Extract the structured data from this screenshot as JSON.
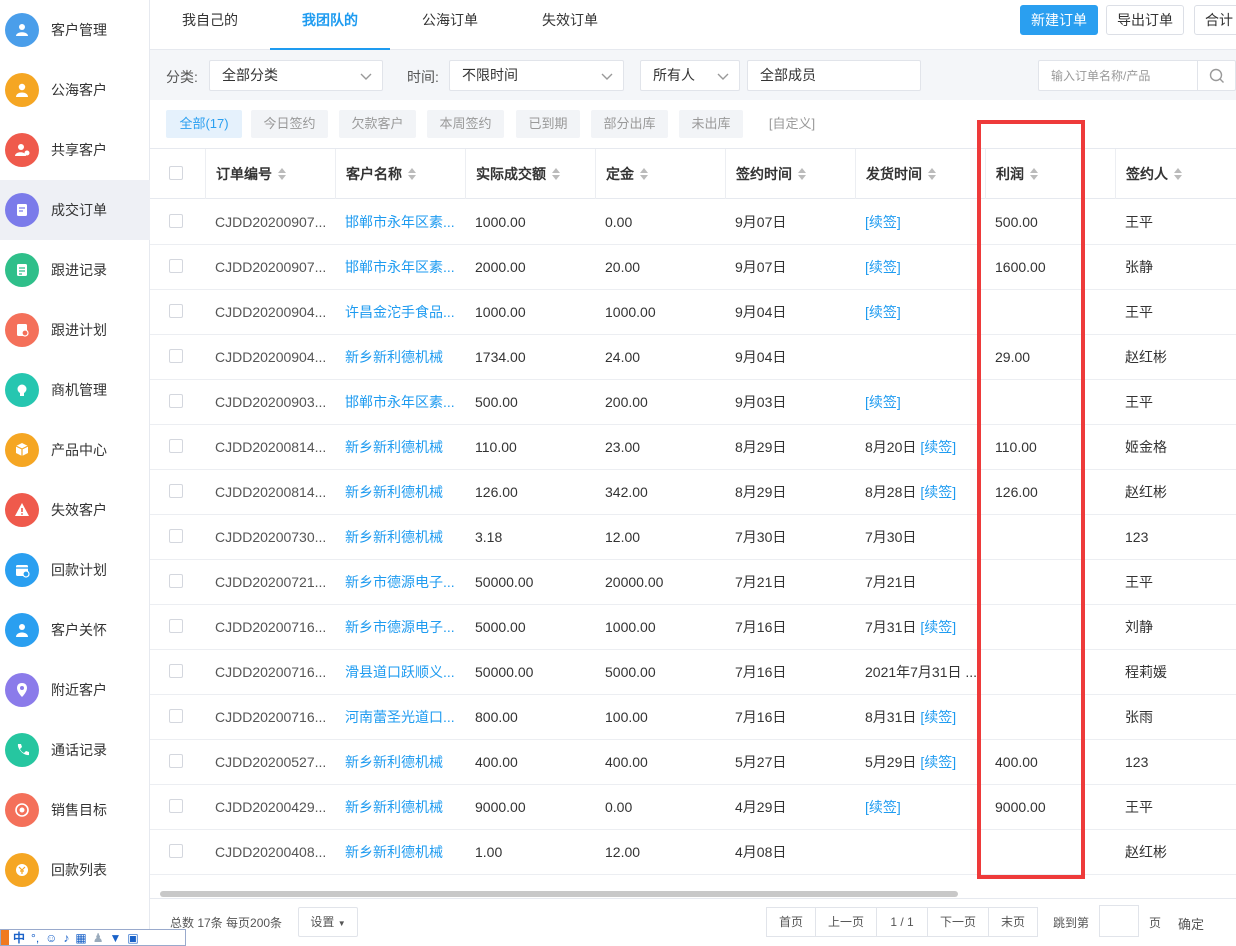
{
  "sidebar": {
    "items": [
      {
        "label": "客户管理",
        "icon": "users-icon",
        "color": "#4a9eea"
      },
      {
        "label": "公海客户",
        "icon": "person-icon",
        "color": "#f5a623"
      },
      {
        "label": "共享客户",
        "icon": "share-user-icon",
        "color": "#ef5a4c"
      },
      {
        "label": "成交订单",
        "icon": "order-icon",
        "color": "#7b7bea"
      },
      {
        "label": "跟进记录",
        "icon": "note-icon",
        "color": "#2fbf8a"
      },
      {
        "label": "跟进计划",
        "icon": "plan-icon",
        "color": "#f4705a"
      },
      {
        "label": "商机管理",
        "icon": "bulb-icon",
        "color": "#26c6b0"
      },
      {
        "label": "产品中心",
        "icon": "box-icon",
        "color": "#f5a623"
      },
      {
        "label": "失效客户",
        "icon": "warning-icon",
        "color": "#ef5a4c"
      },
      {
        "label": "回款计划",
        "icon": "calendar-icon",
        "color": "#2a9ff0"
      },
      {
        "label": "客户关怀",
        "icon": "care-icon",
        "color": "#2a9ff0"
      },
      {
        "label": "附近客户",
        "icon": "location-icon",
        "color": "#8b7bea"
      },
      {
        "label": "通话记录",
        "icon": "phone-icon",
        "color": "#26c6a0"
      },
      {
        "label": "销售目标",
        "icon": "target-icon",
        "color": "#f4705a"
      },
      {
        "label": "回款列表",
        "icon": "money-icon",
        "color": "#f5a623"
      }
    ]
  },
  "tabs": [
    "我自己的",
    "我团队的",
    "公海订单",
    "失效订单"
  ],
  "actions": {
    "new_order": "新建订单",
    "export": "导出订单",
    "total": "合计"
  },
  "filters": {
    "category_label": "分类:",
    "category_value": "全部分类",
    "time_label": "时间:",
    "time_value": "不限时间",
    "owner_value": "所有人",
    "members_value": "全部成员",
    "search_placeholder": "输入订单名称/产品"
  },
  "quick_filters": [
    "全部(17)",
    "今日签约",
    "欠款客户",
    "本周签约",
    "已到期",
    "部分出库",
    "未出库",
    "[自定义]"
  ],
  "table": {
    "columns": [
      "订单编号",
      "客户名称",
      "实际成交额",
      "定金",
      "签约时间",
      "发货时间",
      "利润",
      "签约人"
    ],
    "renew_label": "[续签]",
    "rows": [
      {
        "id": "CJDD20200907...",
        "customer": "邯郸市永年区素...",
        "amount": "1000.00",
        "deposit": "0.00",
        "sign": "9月07日",
        "ship": "",
        "renew": true,
        "profit": "500.00",
        "signer": "王平"
      },
      {
        "id": "CJDD20200907...",
        "customer": "邯郸市永年区素...",
        "amount": "2000.00",
        "deposit": "20.00",
        "sign": "9月07日",
        "ship": "",
        "renew": true,
        "profit": "1600.00",
        "signer": "张静"
      },
      {
        "id": "CJDD20200904...",
        "customer": "许昌金沱手食品...",
        "amount": "1000.00",
        "deposit": "1000.00",
        "sign": "9月04日",
        "ship": "",
        "renew": true,
        "profit": "",
        "signer": "王平"
      },
      {
        "id": "CJDD20200904...",
        "customer": "新乡新利德机械",
        "amount": "1734.00",
        "deposit": "24.00",
        "sign": "9月04日",
        "ship": "",
        "renew": false,
        "profit": "29.00",
        "signer": "赵红彬"
      },
      {
        "id": "CJDD20200903...",
        "customer": "邯郸市永年区素...",
        "amount": "500.00",
        "deposit": "200.00",
        "sign": "9月03日",
        "ship": "",
        "renew": true,
        "profit": "",
        "signer": "王平"
      },
      {
        "id": "CJDD20200814...",
        "customer": "新乡新利德机械",
        "amount": "110.00",
        "deposit": "23.00",
        "sign": "8月29日",
        "ship": "8月20日",
        "renew": true,
        "profit": "110.00",
        "signer": "姬金格"
      },
      {
        "id": "CJDD20200814...",
        "customer": "新乡新利德机械",
        "amount": "126.00",
        "deposit": "342.00",
        "sign": "8月29日",
        "ship": "8月28日",
        "renew": true,
        "profit": "126.00",
        "signer": "赵红彬"
      },
      {
        "id": "CJDD20200730...",
        "customer": "新乡新利德机械",
        "amount": "3.18",
        "deposit": "12.00",
        "sign": "7月30日",
        "ship": "7月30日",
        "renew": false,
        "profit": "",
        "signer": "123"
      },
      {
        "id": "CJDD20200721...",
        "customer": "新乡市德源电子...",
        "amount": "50000.00",
        "deposit": "20000.00",
        "sign": "7月21日",
        "ship": "7月21日",
        "renew": false,
        "profit": "",
        "signer": "王平"
      },
      {
        "id": "CJDD20200716...",
        "customer": "新乡市德源电子...",
        "amount": "5000.00",
        "deposit": "1000.00",
        "sign": "7月16日",
        "ship": "7月31日",
        "renew": true,
        "profit": "",
        "signer": "刘静"
      },
      {
        "id": "CJDD20200716...",
        "customer": "滑县道口跃顺义...",
        "amount": "50000.00",
        "deposit": "5000.00",
        "sign": "7月16日",
        "ship": "2021年7月31日 ...",
        "renew": false,
        "profit": "",
        "signer": "程莉媛"
      },
      {
        "id": "CJDD20200716...",
        "customer": "河南蕾圣光道口...",
        "amount": "800.00",
        "deposit": "100.00",
        "sign": "7月16日",
        "ship": "8月31日",
        "renew": true,
        "profit": "",
        "signer": "张雨"
      },
      {
        "id": "CJDD20200527...",
        "customer": "新乡新利德机械",
        "amount": "400.00",
        "deposit": "400.00",
        "sign": "5月27日",
        "ship": "5月29日",
        "renew": true,
        "profit": "400.00",
        "signer": "123"
      },
      {
        "id": "CJDD20200429...",
        "customer": "新乡新利德机械",
        "amount": "9000.00",
        "deposit": "0.00",
        "sign": "4月29日",
        "ship": "",
        "renew": true,
        "profit": "9000.00",
        "signer": "王平"
      },
      {
        "id": "CJDD20200408...",
        "customer": "新乡新利德机械",
        "amount": "1.00",
        "deposit": "12.00",
        "sign": "4月08日",
        "ship": "",
        "renew": false,
        "profit": "",
        "signer": "赵红彬"
      }
    ]
  },
  "footer": {
    "summary": "总数 17条 每页200条",
    "settings": "设置",
    "first": "首页",
    "prev": "上一页",
    "page": "1 / 1",
    "next": "下一页",
    "last": "末页",
    "jump_label": "跳到第",
    "page_unit": "页",
    "confirm": "确定"
  },
  "ime": {
    "mode": "中"
  },
  "colors": {
    "accent": "#2a9ff0",
    "highlight": "#ee3a3a"
  }
}
